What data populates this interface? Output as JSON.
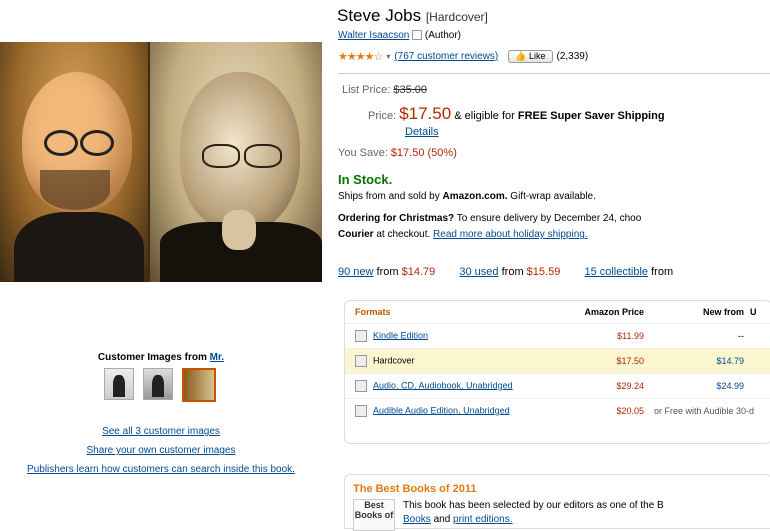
{
  "product": {
    "title": "Steve Jobs",
    "format": "[Hardcover]",
    "author_name": "Walter Isaacson",
    "author_role": "(Author)",
    "stars_display": "★★★★☆",
    "reviews_link": "(767 customer reviews)",
    "like_label": "Like",
    "like_count": "(2,339)"
  },
  "pricing": {
    "list_label": "List Price:",
    "list_price": "$35.00",
    "price_label": "Price:",
    "price": "$17.50",
    "shipping_text": "& eligible for",
    "shipping_bold": "FREE Super Saver Shipping",
    "details_link": "Details",
    "save_label": "You Save:",
    "save_value": "$17.50 (50%)"
  },
  "availability": {
    "status": "In Stock.",
    "ships_prefix": "Ships from and sold by",
    "seller": "Amazon.com.",
    "gift": "Gift-wrap available.",
    "christmas_bold": "Ordering for Christmas?",
    "christmas_text": "To ensure delivery by December 24, choo",
    "courier_bold": "Courier",
    "courier_text": "at checkout.",
    "holiday_link": "Read more about holiday shipping."
  },
  "offers": [
    {
      "link": "90 new",
      "from": "from",
      "price": "$14.79"
    },
    {
      "link": "30 used",
      "from": "from",
      "price": "$15.59"
    },
    {
      "link": "15 collectible",
      "from": "from",
      "price": ""
    }
  ],
  "formats_table": {
    "headers": [
      "Formats",
      "Amazon Price",
      "New from",
      "U"
    ],
    "rows": [
      {
        "format": "Kindle Edition",
        "amazon": "$11.99",
        "new": "--",
        "note": ""
      },
      {
        "format": "Hardcover",
        "amazon": "$17.50",
        "new": "$14.79",
        "note": ""
      },
      {
        "format": "Audio, CD, Audiobook, Unabridged",
        "amazon": "$29.24",
        "new": "$24.99",
        "note": ""
      },
      {
        "format": "Audible Audio Edition, Unabridged",
        "amazon": "$20.05",
        "new": "",
        "note": "or Free with Audible 30-d"
      }
    ]
  },
  "best_books": {
    "title": "The Best Books of 2011",
    "badge": "Best Books of",
    "line1": "This book has been selected by our editors as one of the B",
    "link1": "Books",
    "line2_mid": "and",
    "link2": "print editions."
  },
  "customer_images": {
    "label": "Customer Images from",
    "label_link": "Mr.",
    "links": [
      "See all 3 customer images",
      "Share your own customer images",
      "Publishers learn how customers can search inside this book."
    ]
  },
  "colors": {
    "accent": "#e47911",
    "price_red": "#b12704",
    "link": "#004b91",
    "stock_green": "#007600"
  }
}
